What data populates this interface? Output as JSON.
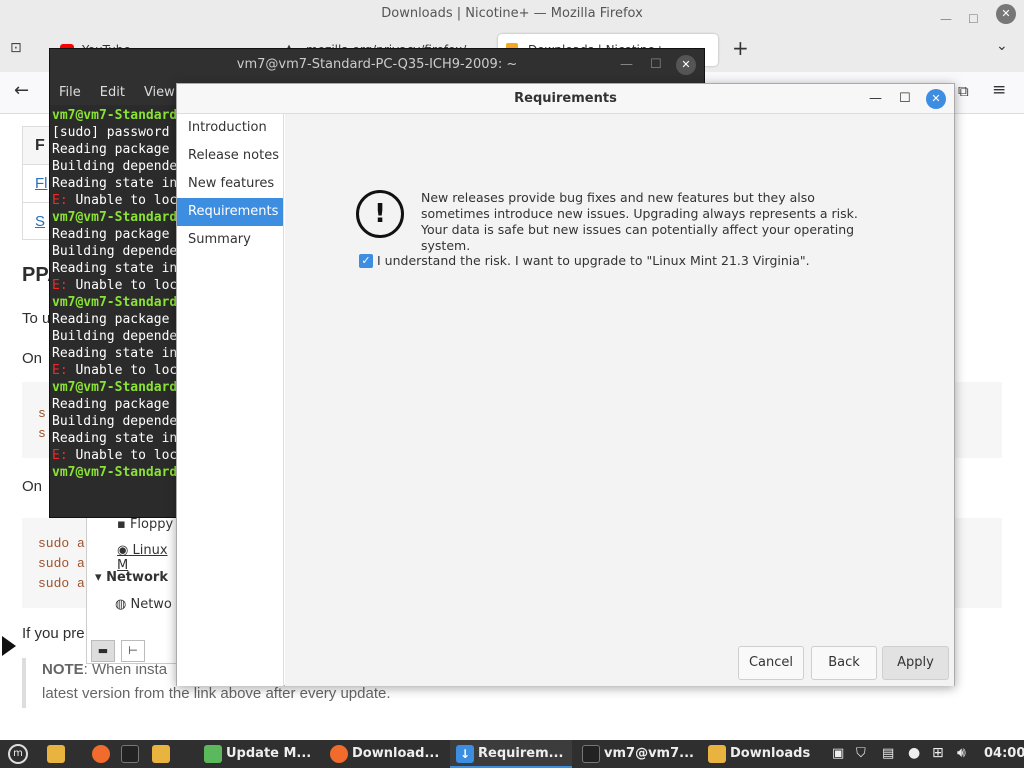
{
  "firefox": {
    "title": "Downloads | Nicotine+ — Mozilla Firefox",
    "tabs": [
      "YouTube",
      "mozilla.org/privacy/firefox/",
      "Downloads | Nicotine+"
    ],
    "content": {
      "heading": "PPA",
      "line1": "To u",
      "line2": "On",
      "line3": "On",
      "line4": "If you pre",
      "note_label": "NOTE",
      "note_text": ": When insta",
      "note_line2": "latest version from the link above after every update.",
      "tbl_head": "F",
      "tbl_l1": "Fl",
      "tbl_l2": "S",
      "code1": [
        "s",
        "s"
      ],
      "code2": [
        "sudo a",
        "sudo a",
        "sudo a"
      ]
    }
  },
  "terminal": {
    "title": "vm7@vm7-Standard-PC-Q35-ICH9-2009: ~",
    "menu": [
      "File",
      "Edit",
      "View"
    ],
    "lines": [
      {
        "c": "g",
        "t": "vm7@vm7-Standard"
      },
      {
        "c": "",
        "t": "[sudo] password"
      },
      {
        "c": "",
        "t": "Reading package"
      },
      {
        "c": "",
        "t": "Building depende"
      },
      {
        "c": "",
        "t": "Reading state in"
      },
      {
        "c": "r",
        "t": "E:",
        "rest": " Unable to loc"
      },
      {
        "c": "g",
        "t": "vm7@vm7-Standard"
      },
      {
        "c": "",
        "t": "Reading package"
      },
      {
        "c": "",
        "t": "Building depende"
      },
      {
        "c": "",
        "t": "Reading state in"
      },
      {
        "c": "r",
        "t": "E:",
        "rest": " Unable to loc"
      },
      {
        "c": "g",
        "t": "vm7@vm7-Standard"
      },
      {
        "c": "",
        "t": "Reading package"
      },
      {
        "c": "",
        "t": "Building depende"
      },
      {
        "c": "",
        "t": "Reading state in"
      },
      {
        "c": "r",
        "t": "E:",
        "rest": " Unable to loc"
      },
      {
        "c": "g",
        "t": "vm7@vm7-Standard"
      },
      {
        "c": "",
        "t": "Reading package"
      },
      {
        "c": "",
        "t": "Building depende"
      },
      {
        "c": "",
        "t": "Reading state in"
      },
      {
        "c": "r",
        "t": "E:",
        "rest": " Unable to loc"
      },
      {
        "c": "g",
        "t": "vm7@vm7-Standard"
      }
    ]
  },
  "filemanager": {
    "items": [
      "Floppy",
      "Linux M",
      "Network",
      "Netwo"
    ]
  },
  "dialog": {
    "title": "Requirements",
    "sidebar": [
      "Introduction",
      "Release notes",
      "New features",
      "Requirements",
      "Summary"
    ],
    "message": "New releases provide bug fixes and new features but they also sometimes introduce new issues. Upgrading always represents a risk. Your data is safe but new issues can potentially affect your operating system.",
    "checkbox_label": "I understand the risk. I want to upgrade to \"Linux Mint 21.3 Virginia\".",
    "buttons": {
      "cancel": "Cancel",
      "back": "Back",
      "apply": "Apply"
    }
  },
  "taskbar": {
    "items": [
      "Update M...",
      "Download...",
      "Requirem...",
      "vm7@vm7...",
      "Downloads"
    ],
    "clock": "04:00"
  }
}
